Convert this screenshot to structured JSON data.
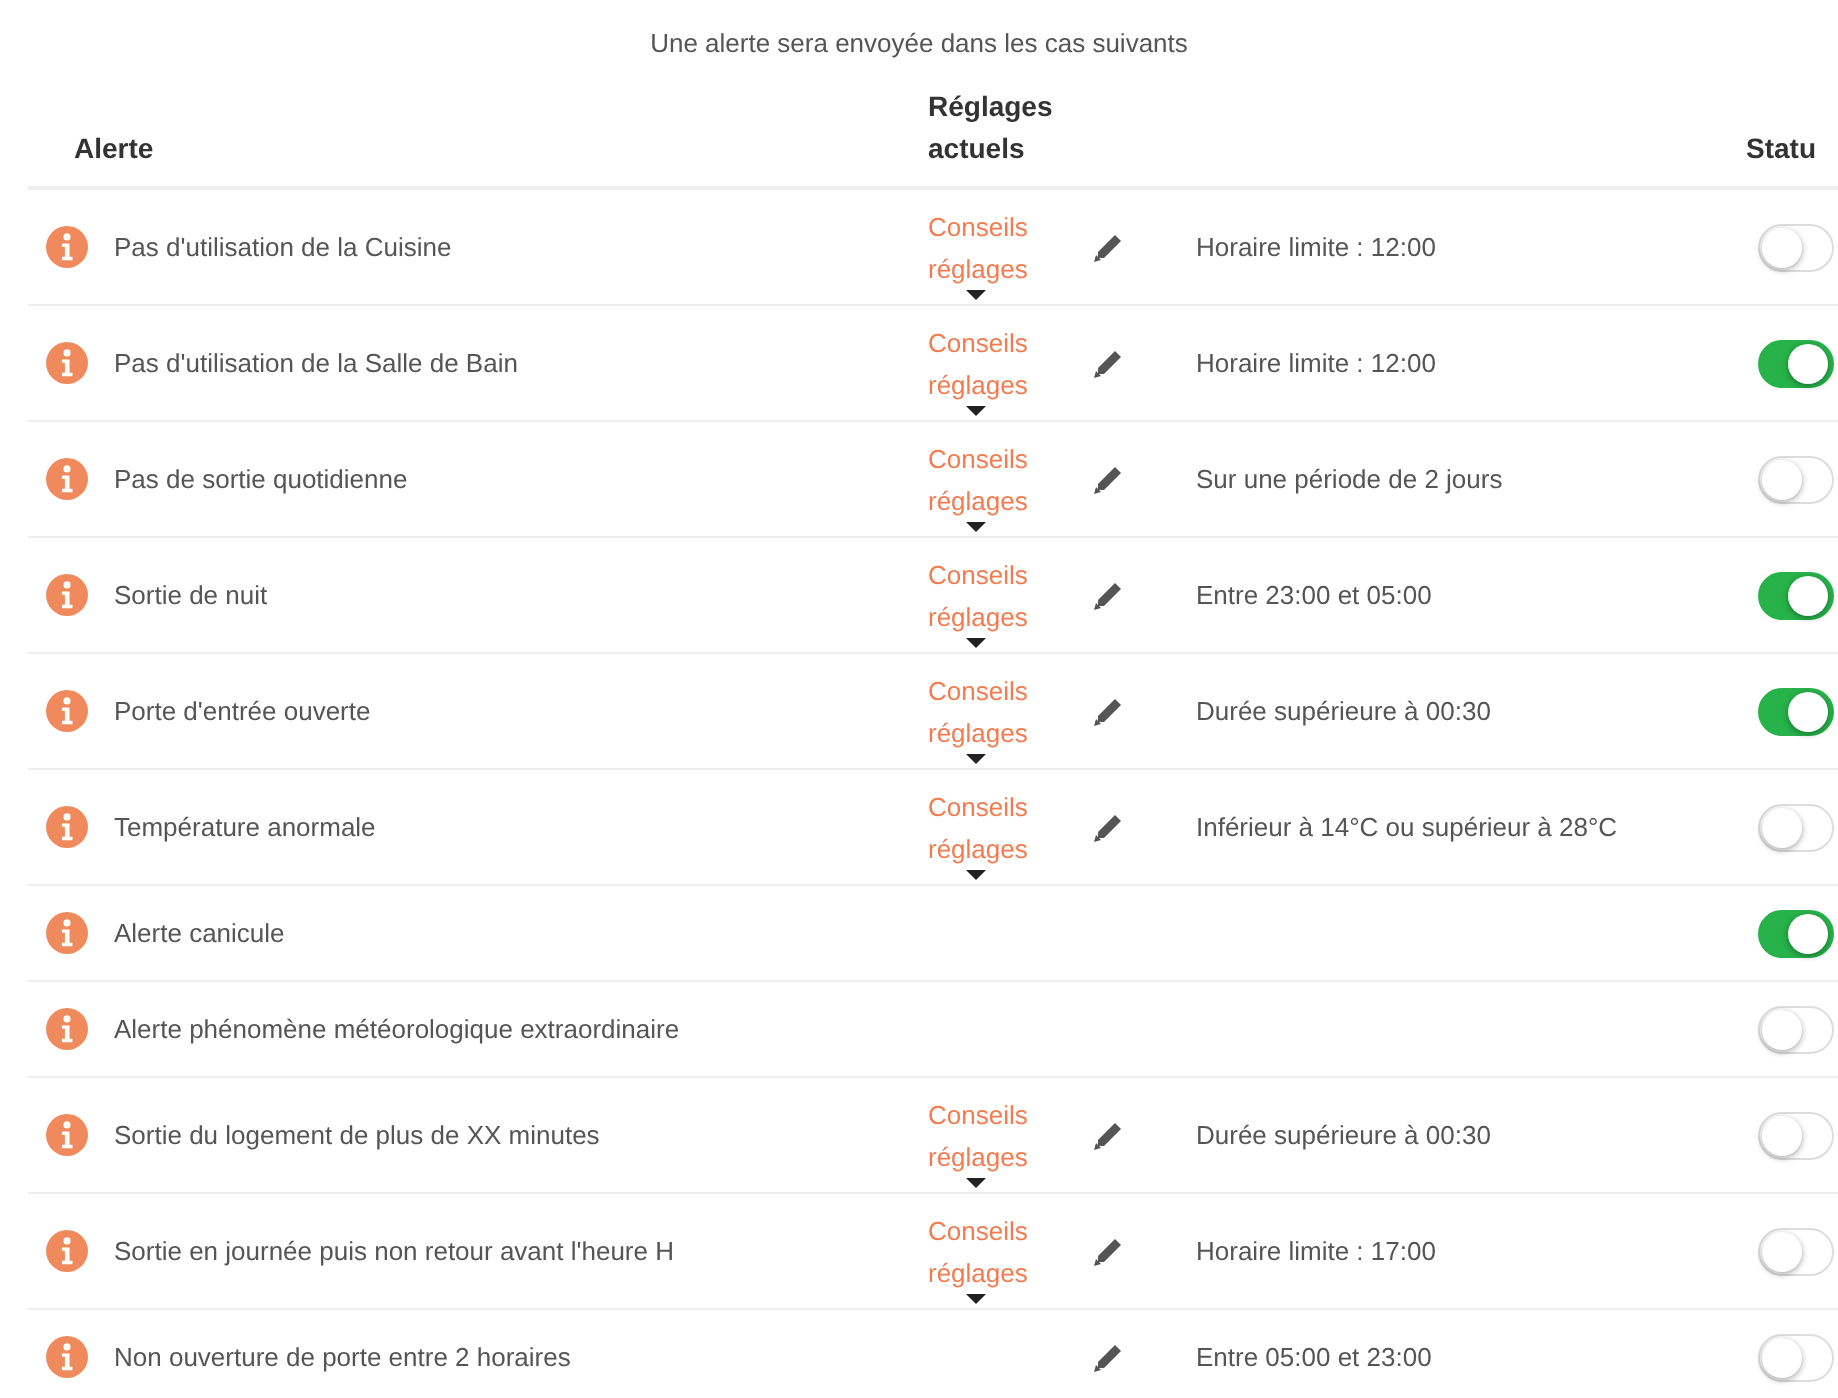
{
  "intro": "Une alerte sera envoyée dans les cas suivants",
  "columns": {
    "alert": "Alerte",
    "settings": "Réglages actuels",
    "status": "Statu"
  },
  "rows": [
    {
      "alert": "Pas d'utilisation de la Cuisine",
      "advice": "Conseils réglages",
      "editable": true,
      "setting": "Horaire limite : 12:00",
      "on": false
    },
    {
      "alert": "Pas d'utilisation de la Salle de Bain",
      "advice": "Conseils réglages",
      "editable": true,
      "setting": "Horaire limite : 12:00",
      "on": true
    },
    {
      "alert": "Pas de sortie quotidienne",
      "advice": "Conseils réglages",
      "editable": true,
      "setting": "Sur une période de 2 jours",
      "on": false
    },
    {
      "alert": "Sortie de nuit",
      "advice": "Conseils réglages",
      "editable": true,
      "setting": "Entre 23:00 et 05:00",
      "on": true
    },
    {
      "alert": "Porte d'entrée ouverte",
      "advice": "Conseils réglages",
      "editable": true,
      "setting": "Durée supérieure à 00:30",
      "on": true
    },
    {
      "alert": "Température anormale",
      "advice": "Conseils réglages",
      "editable": true,
      "setting": "Inférieur à 14°C ou supérieur à 28°C",
      "on": false
    },
    {
      "alert": "Alerte canicule",
      "editable": false,
      "on": true
    },
    {
      "alert": "Alerte phénomène météorologique extraordinaire",
      "editable": false,
      "on": false
    },
    {
      "alert": "Sortie du logement de plus de XX minutes",
      "advice": "Conseils réglages",
      "editable": true,
      "setting": "Durée supérieure à 00:30",
      "on": false
    },
    {
      "alert": "Sortie en journée puis non retour avant l'heure H",
      "advice": "Conseils réglages",
      "editable": true,
      "setting": "Horaire limite : 17:00",
      "on": false
    },
    {
      "alert": "Non ouverture de porte entre 2 horaires",
      "editable": true,
      "setting": "Entre 05:00 et 23:00",
      "on": false
    }
  ]
}
